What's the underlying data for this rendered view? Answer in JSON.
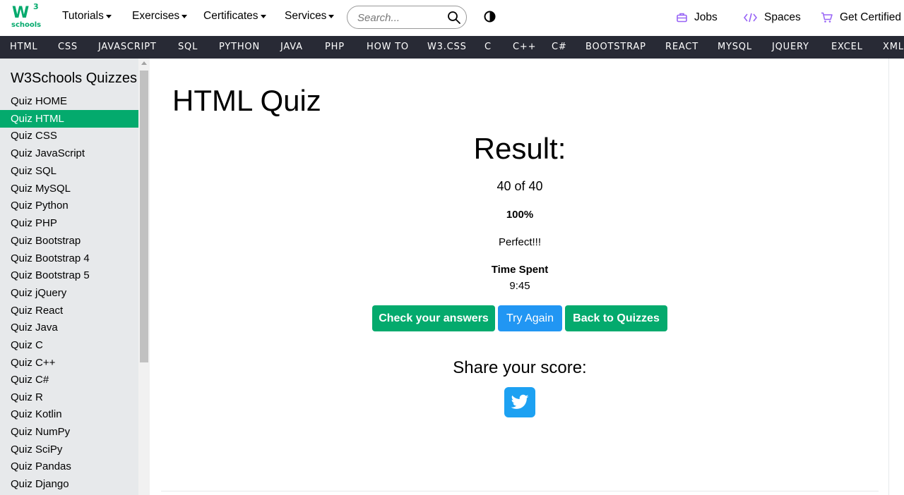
{
  "header": {
    "logo": {
      "main": "W",
      "superscript": "3",
      "sub": "schools"
    },
    "menus": [
      {
        "label": "Tutorials"
      },
      {
        "label": "Exercises"
      },
      {
        "label": "Certificates"
      },
      {
        "label": "Services"
      }
    ],
    "search": {
      "placeholder": "Search...",
      "value": ""
    },
    "right_links": [
      {
        "label": "Jobs",
        "icon": "briefcase-icon"
      },
      {
        "label": "Spaces",
        "icon": "code-icon"
      },
      {
        "label": "Get Certified",
        "icon": "cart-icon"
      }
    ],
    "accent_color": "#9763F6"
  },
  "tutorial_bar": [
    "HTML",
    "CSS",
    "JAVASCRIPT",
    "SQL",
    "PYTHON",
    "JAVA",
    "PHP",
    "HOW TO",
    "W3.CSS",
    "C",
    "C++",
    "C#",
    "BOOTSTRAP",
    "REACT",
    "MYSQL",
    "JQUERY",
    "EXCEL",
    "XML"
  ],
  "sidebar": {
    "title": "W3Schools Quizzes",
    "items": [
      "Quiz HOME",
      "Quiz HTML",
      "Quiz CSS",
      "Quiz JavaScript",
      "Quiz SQL",
      "Quiz MySQL",
      "Quiz Python",
      "Quiz PHP",
      "Quiz Bootstrap",
      "Quiz Bootstrap 4",
      "Quiz Bootstrap 5",
      "Quiz jQuery",
      "Quiz React",
      "Quiz Java",
      "Quiz C",
      "Quiz C++",
      "Quiz C#",
      "Quiz R",
      "Quiz Kotlin",
      "Quiz NumPy",
      "Quiz SciPy",
      "Quiz Pandas",
      "Quiz Django"
    ],
    "active_item": "Quiz HTML"
  },
  "main": {
    "title": "HTML Quiz",
    "result_heading": "Result:",
    "score": "40 of 40",
    "percent": "100%",
    "verdict": "Perfect!!!",
    "time_label": "Time Spent",
    "time_value": "9:45",
    "buttons": {
      "check": "Check your answers",
      "retry": "Try Again",
      "back": "Back to Quizzes"
    },
    "share_label": "Share your score:"
  },
  "colors": {
    "brand_green": "#04AA6D",
    "dark_bar": "#282A35",
    "sidebar_bg": "#E7E9EB",
    "blue_button": "#2196F3",
    "twitter": "#1DA1F2"
  }
}
